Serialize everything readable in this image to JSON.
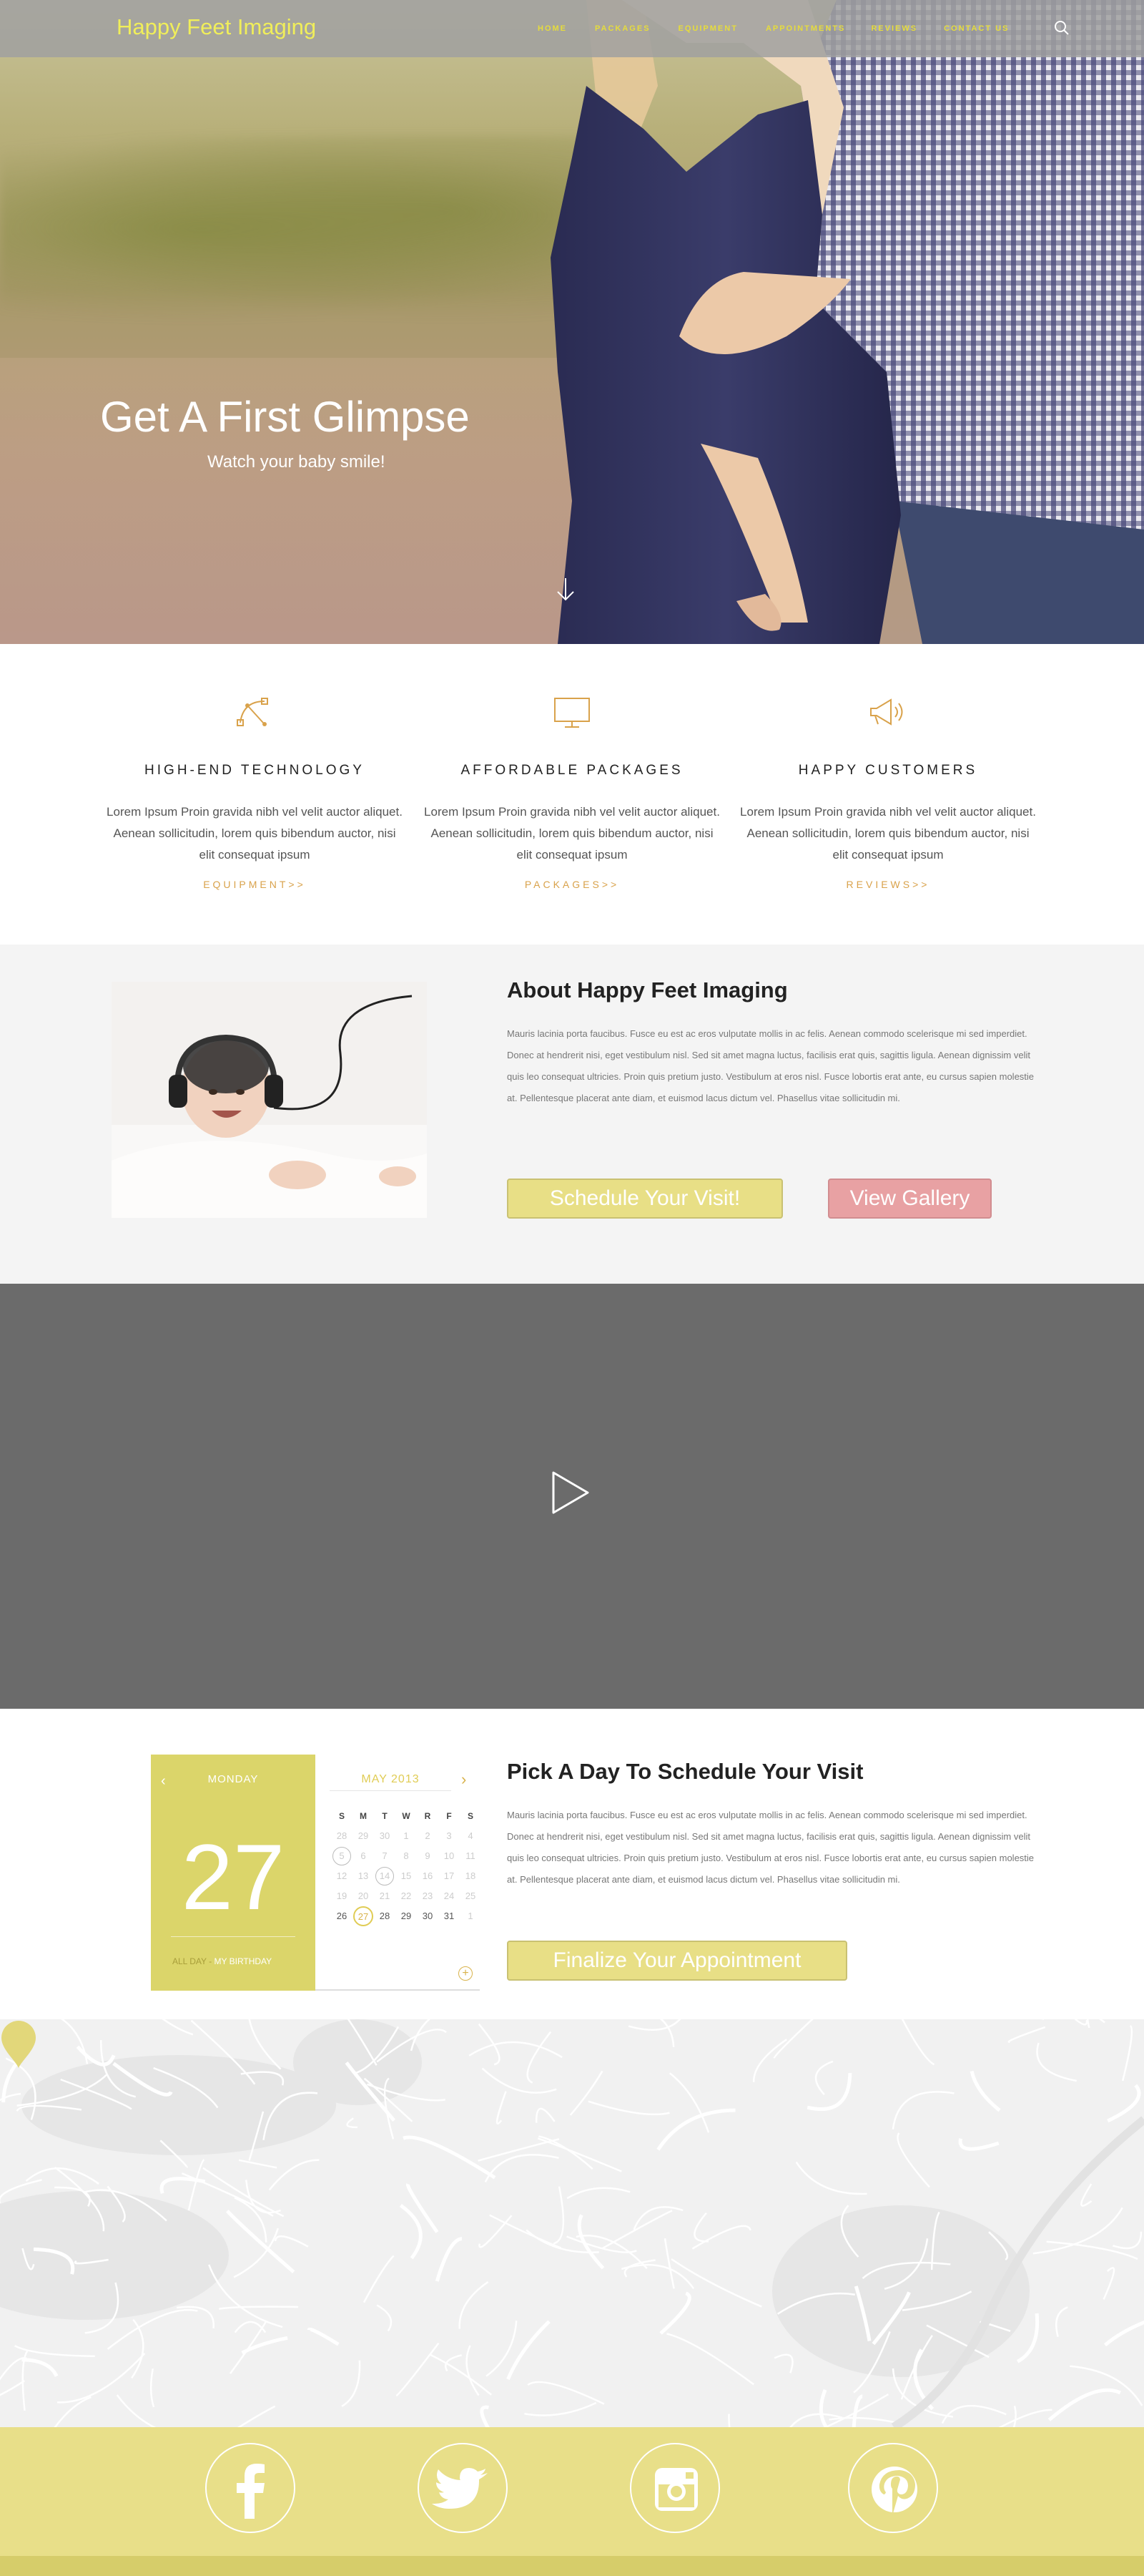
{
  "brand": "Happy Feet Imaging",
  "nav": {
    "items": [
      "HOME",
      "PACKAGES",
      "EQUIPMENT",
      "APPOINTMENTS",
      "REVIEWS",
      "CONTACT US"
    ],
    "search_icon": "search-icon"
  },
  "hero": {
    "title": "Get A First Glimpse",
    "subtitle": "Watch your baby smile!",
    "scroll_icon": "arrow-down-icon"
  },
  "features": [
    {
      "icon": "bezier-curve-icon",
      "title": "HIGH-END TECHNOLOGY",
      "text": "Lorem Ipsum Proin gravida nibh vel  velit auctor aliquet. Aenean sollicitudin, lorem quis bibendum auctor, nisi elit consequat ipsum",
      "link": "EQUIPMENT>>"
    },
    {
      "icon": "monitor-icon",
      "title": "AFFORDABLE PACKAGES",
      "text": "Lorem Ipsum Proin gravida nibh vel  velit auctor aliquet. Aenean sollicitudin, lorem quis bibendum auctor, nisi elit consequat ipsum",
      "link": "PACKAGES>>"
    },
    {
      "icon": "megaphone-icon",
      "title": "HAPPY CUSTOMERS",
      "text": "Lorem Ipsum Proin gravida nibh vel  velit auctor aliquet. Aenean sollicitudin, lorem quis bibendum auctor, nisi elit consequat ipsum",
      "link": "REVIEWS>>"
    }
  ],
  "about": {
    "title": "About Happy Feet Imaging",
    "text": "Mauris lacinia porta faucibus. Fusce eu est ac eros vulputate mollis in ac felis. Aenean commodo scelerisque mi sed imperdiet. Donec at hendrerit nisi, eget vestibulum nisl. Sed sit amet magna luctus, facilisis erat quis, sagittis ligula. Aenean dignissim velit quis leo consequat ultricies. Proin quis pretium justo. Vestibulum at eros nisl. Fusce lobortis erat ante, eu cursus sapien molestie at. Pellentesque placerat ante diam, et euismod lacus dictum vel. Phasellus vitae sollicitudin mi.",
    "primary_button": "Schedule Your Visit!",
    "secondary_button": "View Gallery"
  },
  "video": {
    "play_icon": "play-icon"
  },
  "calendar": {
    "weekday": "MONDAY",
    "day": "27",
    "month": "MAY 2013",
    "event_label": "ALL DAY -",
    "event_name": "MY BIRTHDAY",
    "weekday_headers": [
      "S",
      "M",
      "T",
      "W",
      "R",
      "F",
      "S"
    ],
    "days": [
      "28",
      "29",
      "30",
      "1",
      "2",
      "3",
      "4",
      "5",
      "6",
      "7",
      "8",
      "9",
      "10",
      "11",
      "12",
      "13",
      "14",
      "15",
      "16",
      "17",
      "18",
      "19",
      "20",
      "21",
      "22",
      "23",
      "24",
      "25",
      "26",
      "27",
      "28",
      "29",
      "30",
      "31",
      "1"
    ],
    "add_label": "+"
  },
  "schedule": {
    "title": "Pick A Day To Schedule Your Visit",
    "text": "Mauris lacinia porta faucibus. Fusce eu est ac eros vulputate mollis in ac felis. Aenean commodo scelerisque mi sed imperdiet. Donec at hendrerit nisi, eget vestibulum nisl. Sed sit amet magna luctus, facilisis erat quis, sagittis ligula. Aenean dignissim velit quis leo consequat ultricies. Proin quis pretium justo. Vestibulum at eros nisl. Fusce lobortis erat ante, eu cursus sapien molestie at. Pellentesque placerat ante diam, et euismod lacus dictum vel. Phasellus vitae sollicitudin mi.",
    "button": "Finalize Your Appointment"
  },
  "social": [
    "facebook-icon",
    "twitter-icon",
    "instagram-icon",
    "pinterest-icon"
  ],
  "colors": {
    "brand_yellow": "#e8df86",
    "accent_orange": "#d9a24b",
    "pink": "#e8a1a3",
    "video_bg": "#6b6b6b"
  }
}
